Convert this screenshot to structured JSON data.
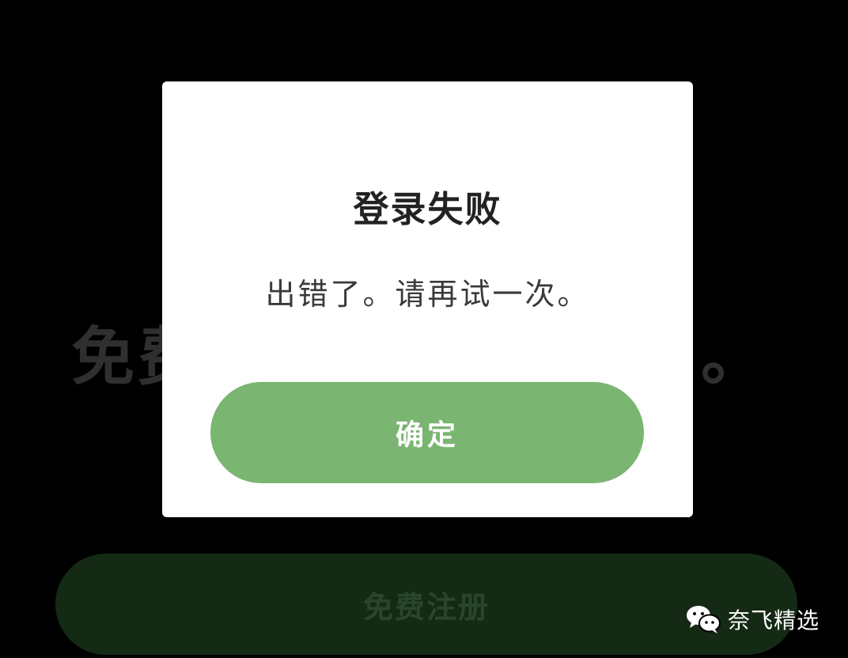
{
  "background": {
    "headline_left": "免费",
    "headline_right": "曲。",
    "signup_label": "免费注册"
  },
  "dialog": {
    "title": "登录失败",
    "message": "出错了。请再试一次。",
    "confirm_label": "确定"
  },
  "watermark": {
    "icon": "wechat-icon",
    "text": "奈飞精选"
  },
  "colors": {
    "overlay": "#000000",
    "dialog_bg": "#ffffff",
    "accent_green": "#7ab571"
  }
}
